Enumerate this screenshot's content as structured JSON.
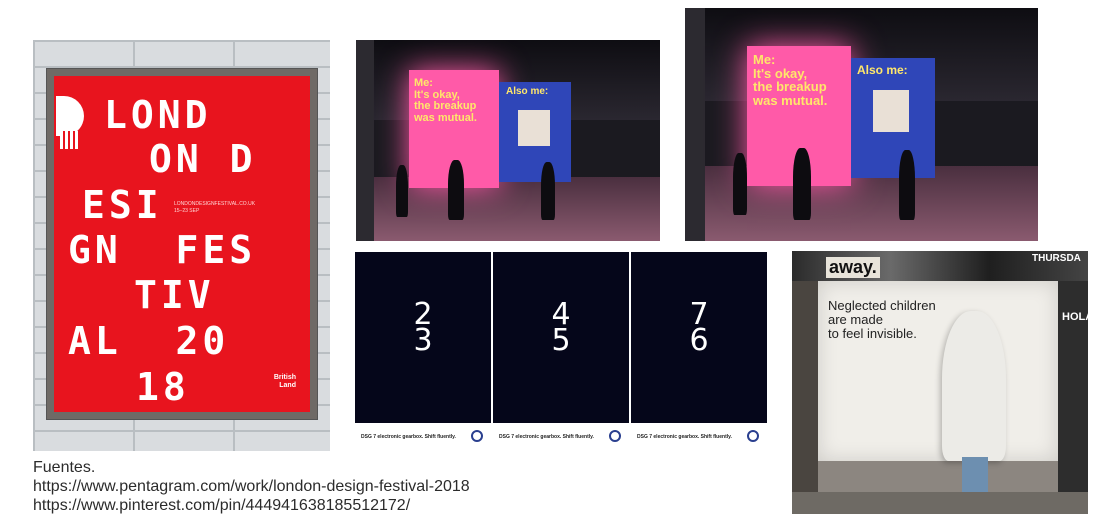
{
  "poster_london": {
    "lines": [
      "LOND",
      "ON D",
      "ESI",
      "GN  FES",
      "TIV",
      "AL  20",
      "18"
    ],
    "small_text": [
      "LONDONDESIGNFESTIVAL.CO.UK",
      "15–23 SEP"
    ],
    "brand": [
      "British",
      "Land"
    ]
  },
  "spotify": {
    "pink_text": "Me:\nIt's okay,\nthe breakup\nwas mutual.",
    "blue_text": "Also me:"
  },
  "vw": {
    "panels": [
      {
        "top": "2",
        "bottom": "3"
      },
      {
        "top": "4",
        "bottom": "5"
      },
      {
        "top": "7",
        "bottom": "6"
      }
    ],
    "tagline": "DSG 7 electronic gearbox. Shift fluently."
  },
  "invisible": {
    "message": "Neglected children\nare made\nto feel invisible.",
    "wall_text": [
      "away.",
      "THURSDA",
      "HOLA"
    ]
  },
  "caption": {
    "heading": "Fuentes.",
    "links": [
      "https://www.pentagram.com/work/london-design-festival-2018",
      "https://www.pinterest.com/pin/444941638185512172/"
    ]
  }
}
